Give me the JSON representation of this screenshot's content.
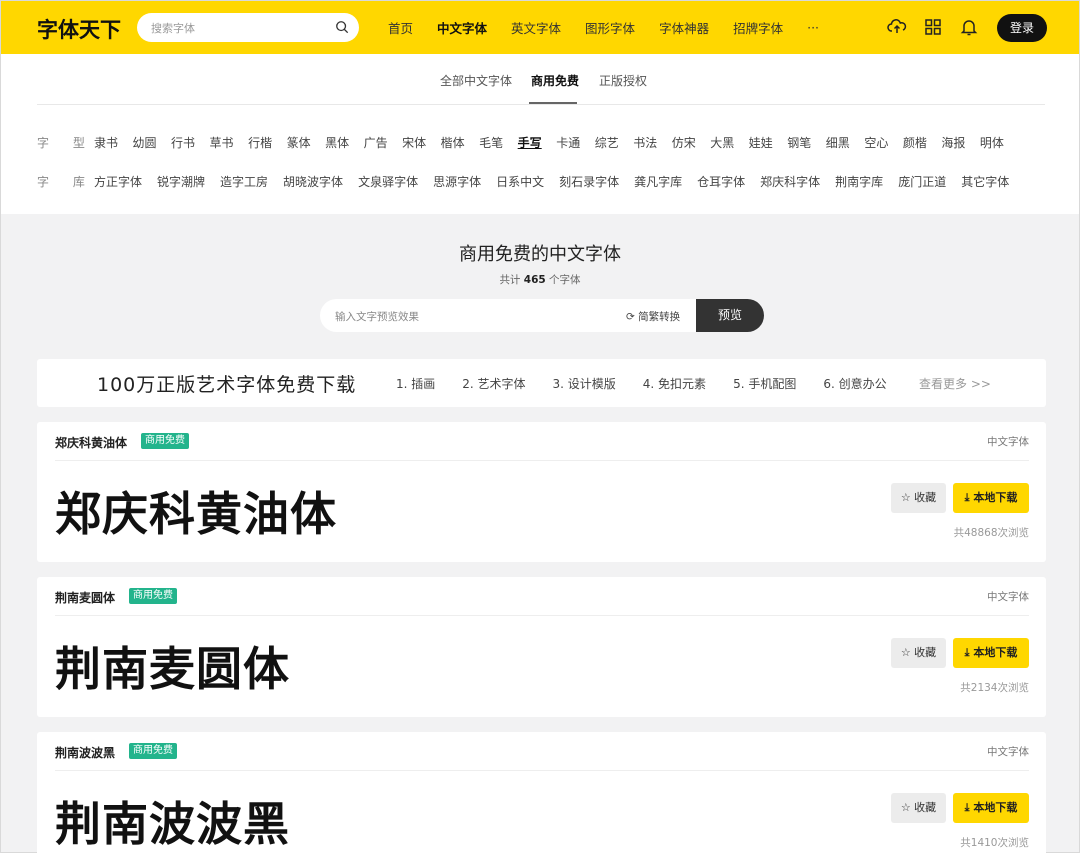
{
  "header": {
    "logo": "字体天下",
    "search_placeholder": "搜索字体",
    "nav": [
      "首页",
      "中文字体",
      "英文字体",
      "图形字体",
      "字体神器",
      "招牌字体",
      "···"
    ],
    "nav_active_index": 1,
    "login": "登录",
    "accent_color": "#ffd700"
  },
  "tabs": {
    "items": [
      "全部中文字体",
      "商用免费",
      "正版授权"
    ],
    "active": "商用免费"
  },
  "filters": {
    "type_label": "字 型",
    "type_options": [
      "隶书",
      "幼圆",
      "行书",
      "草书",
      "行楷",
      "篆体",
      "黑体",
      "广告",
      "宋体",
      "楷体",
      "毛笔",
      "手写",
      "卡通",
      "综艺",
      "书法",
      "仿宋",
      "大黑",
      "娃娃",
      "钢笔",
      "细黑",
      "空心",
      "颜楷",
      "海报",
      "明体"
    ],
    "type_selected": "手写",
    "library_label": "字 库",
    "library_options": [
      "方正字体",
      "锐字潮牌",
      "造字工房",
      "胡晓波字体",
      "文泉驿字体",
      "思源字体",
      "日系中文",
      "刻石录字体",
      "龚凡字库",
      "仓耳字体",
      "郑庆科字体",
      "荆南字库",
      "庞门正道",
      "其它字体"
    ]
  },
  "hero": {
    "title": "商用免费的中文字体",
    "count_prefix": "共计",
    "count": "465",
    "count_suffix": "个字体",
    "preview_placeholder": "输入文字预览效果",
    "convert_label": "简繁转换",
    "preview_button": "预览"
  },
  "banner": {
    "headline": "100万正版艺术字体免费下载",
    "links": [
      "1. 插画",
      "2. 艺术字体",
      "3. 设计模版",
      "4. 免扣元素",
      "5. 手机配图",
      "6. 创意办公"
    ],
    "more": "查看更多 >>"
  },
  "fonts": [
    {
      "name": "郑庆科黄油体",
      "badge": "商用免费",
      "category": "中文字体",
      "sample": "郑庆科黄油体",
      "fav": "☆ 收藏",
      "download": "⤓ 本地下载",
      "views": "共48868次浏览"
    },
    {
      "name": "荆南麦圆体",
      "badge": "商用免费",
      "category": "中文字体",
      "sample": "荆南麦圆体",
      "fav": "☆ 收藏",
      "download": "⤓ 本地下载",
      "views": "共2134次浏览"
    },
    {
      "name": "荆南波波黑",
      "badge": "商用免费",
      "category": "中文字体",
      "sample": "荆南波波黑",
      "fav": "☆ 收藏",
      "download": "⤓ 本地下载",
      "views": "共1410次浏览"
    }
  ]
}
